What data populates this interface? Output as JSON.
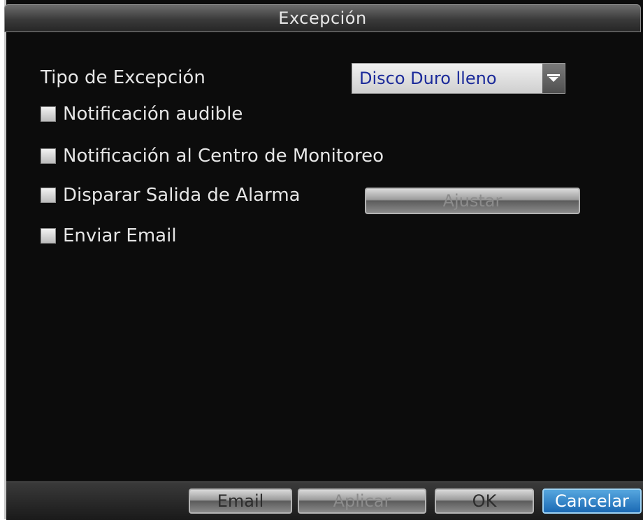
{
  "window": {
    "title": "Excepción"
  },
  "exception_type": {
    "label": "Tipo de Excepción",
    "selected": "Disco Duro lleno"
  },
  "options": [
    {
      "label": "Notificación audible",
      "checked": false
    },
    {
      "label": "Notificación al Centro de Monitoreo",
      "checked": false
    },
    {
      "label": "Disparar Salida de Alarma",
      "checked": false
    },
    {
      "label": "Enviar Email",
      "checked": false
    }
  ],
  "buttons": {
    "ajustar": "Ajustar",
    "email": "Email",
    "aplicar": "Aplicar",
    "ok": "OK",
    "cancelar": "Cancelar"
  },
  "icons": {
    "dropdown": "chevron-down-icon",
    "checkbox": "checkbox-icon"
  },
  "colors": {
    "background": "#0c0c0c",
    "label": "#e6e6e6",
    "selected_text": "#1b2a9a",
    "accent": "#1b69b4"
  }
}
